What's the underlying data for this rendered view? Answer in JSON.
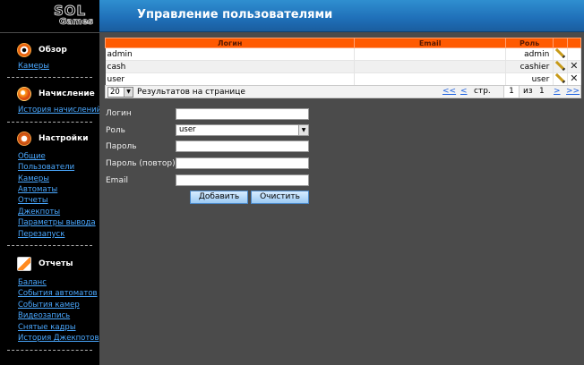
{
  "app": {
    "logo_top": "SOL",
    "logo_bottom": "Games",
    "title": "Управление пользователями"
  },
  "sidebar": {
    "sections": [
      {
        "title": "Обзор",
        "icon": "eye-icon",
        "links": [
          "Камеры"
        ]
      },
      {
        "title": "Начисление",
        "icon": "coin-icon",
        "links": [
          "История начислений"
        ]
      },
      {
        "title": "Настройки",
        "icon": "gear-icon",
        "links": [
          "Общие",
          "Пользователи",
          "Камеры",
          "Автоматы",
          "Отчеты",
          "Джекпоты",
          "Параметры вывода",
          "Перезапуск"
        ]
      },
      {
        "title": "Отчеты",
        "icon": "report-icon",
        "links": [
          "Баланс",
          "События автоматов",
          "События камер",
          "Видеозапись",
          "Снятые кадры",
          "История Джекпотов"
        ]
      }
    ]
  },
  "users_table": {
    "headers": {
      "login": "Логин",
      "email": "Email",
      "role": "Роль"
    },
    "rows": [
      {
        "login": "admin",
        "email": "",
        "role": "admin"
      },
      {
        "login": "cash",
        "email": "",
        "role": "cashier"
      },
      {
        "login": "user",
        "email": "",
        "role": "user"
      }
    ]
  },
  "pager": {
    "per_page": "20",
    "per_page_label": "Результатов на странице",
    "first": "<<",
    "prev": "<",
    "page_label": "стр.",
    "page": "1",
    "of_label": "из",
    "total": "1",
    "next": ">",
    "last": ">>"
  },
  "form": {
    "login_label": "Логин",
    "login_value": "",
    "role_label": "Роль",
    "role_value": "user",
    "password_label": "Пароль",
    "password_value": "",
    "password_repeat_label": "Пароль (повтор)",
    "password_repeat_value": "",
    "email_label": "Email",
    "email_value": "",
    "add_button": "Добавить",
    "clear_button": "Очистить"
  }
}
